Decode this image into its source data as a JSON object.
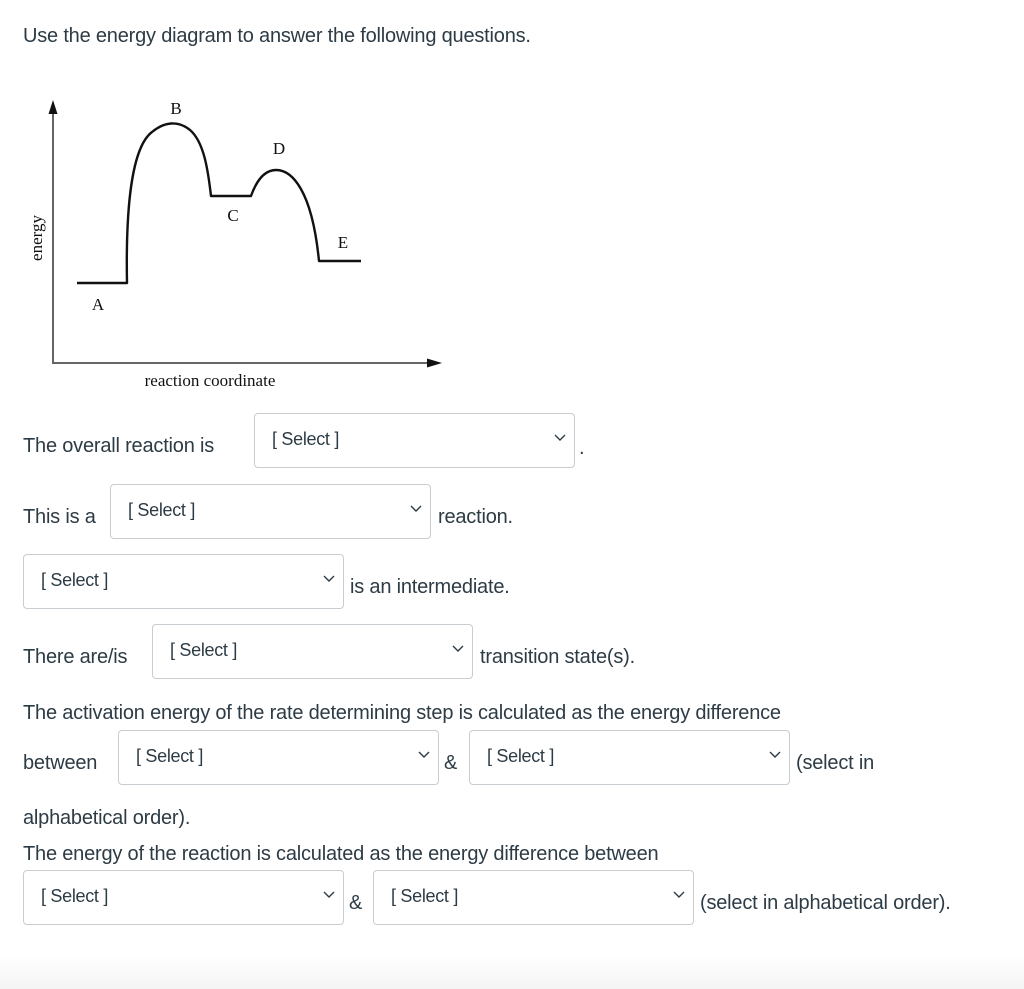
{
  "prompt": "Use the energy diagram to answer the following questions.",
  "diagram": {
    "y_axis_label": "energy",
    "x_axis_label": "reaction coordinate",
    "points": [
      {
        "label": "A",
        "kind": "reactant",
        "relative_energy": "lowest"
      },
      {
        "label": "B",
        "kind": "peak",
        "relative_energy": "highest"
      },
      {
        "label": "C",
        "kind": "valley"
      },
      {
        "label": "D",
        "kind": "peak"
      },
      {
        "label": "E",
        "kind": "product"
      }
    ]
  },
  "questions": {
    "q1": {
      "before": "The overall reaction is",
      "after": "."
    },
    "q2": {
      "before": "This is a",
      "after": "reaction."
    },
    "q3": {
      "after": "is an intermediate."
    },
    "q4": {
      "before": "There are/is",
      "after": "transition state(s)."
    },
    "q5": {
      "line1": "The activation energy of the rate determining step is calculated as the energy difference",
      "before": "between",
      "amp": "&",
      "after": "(select in",
      "line3": "alphabetical order)."
    },
    "q6": {
      "line1": "The energy of the reaction is calculated as the energy difference between",
      "amp": "&",
      "after": "(select in alphabetical order)."
    }
  },
  "selects": [
    {
      "id": "overall-reaction",
      "value": "[ Select ]"
    },
    {
      "id": "reaction-type",
      "value": "[ Select ]"
    },
    {
      "id": "intermediate",
      "value": "[ Select ]"
    },
    {
      "id": "transition-state-count",
      "value": "[ Select ]"
    },
    {
      "id": "activation-energy-first",
      "value": "[ Select ]"
    },
    {
      "id": "activation-energy-second",
      "value": "[ Select ]"
    },
    {
      "id": "reaction-energy-first",
      "value": "[ Select ]"
    },
    {
      "id": "reaction-energy-second",
      "value": "[ Select ]"
    }
  ]
}
